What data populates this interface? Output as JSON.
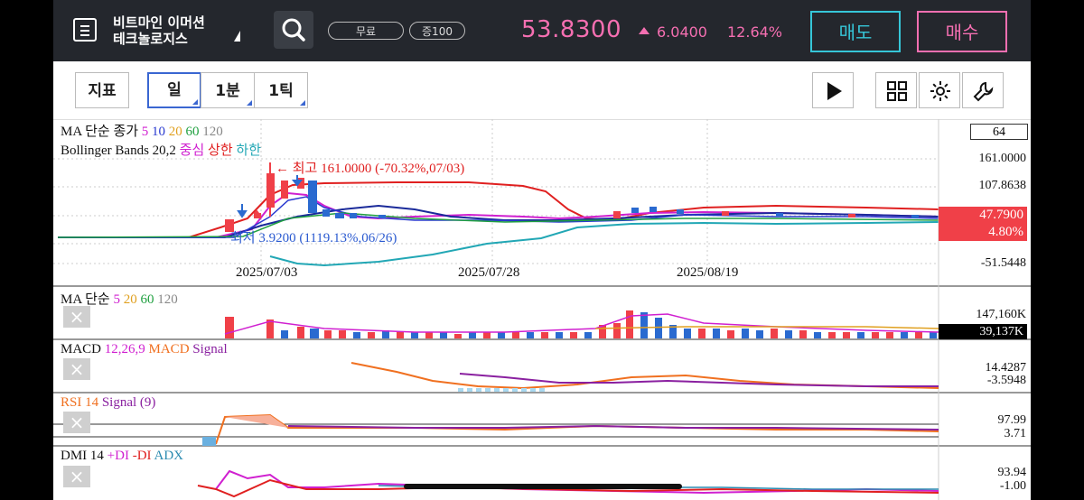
{
  "header": {
    "stock_name_line1": "비트마인 이머션",
    "stock_name_line2": "테크놀로지스",
    "pill_free": "무료",
    "pill_margin": "증100",
    "price": "53.8300",
    "change": "6.0400",
    "change_pct": "12.64%",
    "sell_label": "매도",
    "buy_label": "매수",
    "colors": {
      "up": "#f56fb1",
      "sell": "#36c6d8",
      "bg": "#24272d"
    }
  },
  "toolbar": {
    "indicator_label": "지표",
    "period_day": "일",
    "period_1min": "1분",
    "period_1tick": "1틱",
    "icons": [
      "play-icon",
      "grid-icon",
      "settings-icon",
      "wrench-icon"
    ]
  },
  "main_chart": {
    "ma_title": "MA 단순 종가",
    "ma_periods": [
      "5",
      "10",
      "20",
      "60",
      "120"
    ],
    "bb_title": "Bollinger Bands 20,2",
    "bb_center": "중심",
    "bb_upper": "상한",
    "bb_lower": "하한",
    "high_note": "← 최고 161.0000 (-70.32%,07/03)",
    "low_note": "최저 3.9200 (1119.13%,06/26)",
    "box_value": "64",
    "y_labels": [
      "161.0000",
      "107.8638",
      "-51.5448"
    ],
    "current_price": "47.7900",
    "current_pct": "4.80%",
    "dates": [
      "2025/07/03",
      "2025/07/28",
      "2025/08/19"
    ]
  },
  "volume_panel": {
    "title": "MA 단순",
    "periods": [
      "5",
      "20",
      "60",
      "120"
    ],
    "y_label": "147,160K",
    "current": "39,137K"
  },
  "macd_panel": {
    "title": "MACD",
    "params": "12,26,9",
    "macd_label": "MACD",
    "signal_label": "Signal",
    "y_top": "14.4287",
    "y_bottom": "-3.5948"
  },
  "rsi_panel": {
    "title": "RSI 14",
    "signal_label": "Signal (9)",
    "y_top": "97.99",
    "y_bottom": "3.71"
  },
  "dmi_panel": {
    "title": "DMI 14",
    "plus_di": "+DI",
    "minus_di": "-DI",
    "adx": "ADX",
    "y_top": "93.94",
    "y_bottom": "-1.00"
  }
}
